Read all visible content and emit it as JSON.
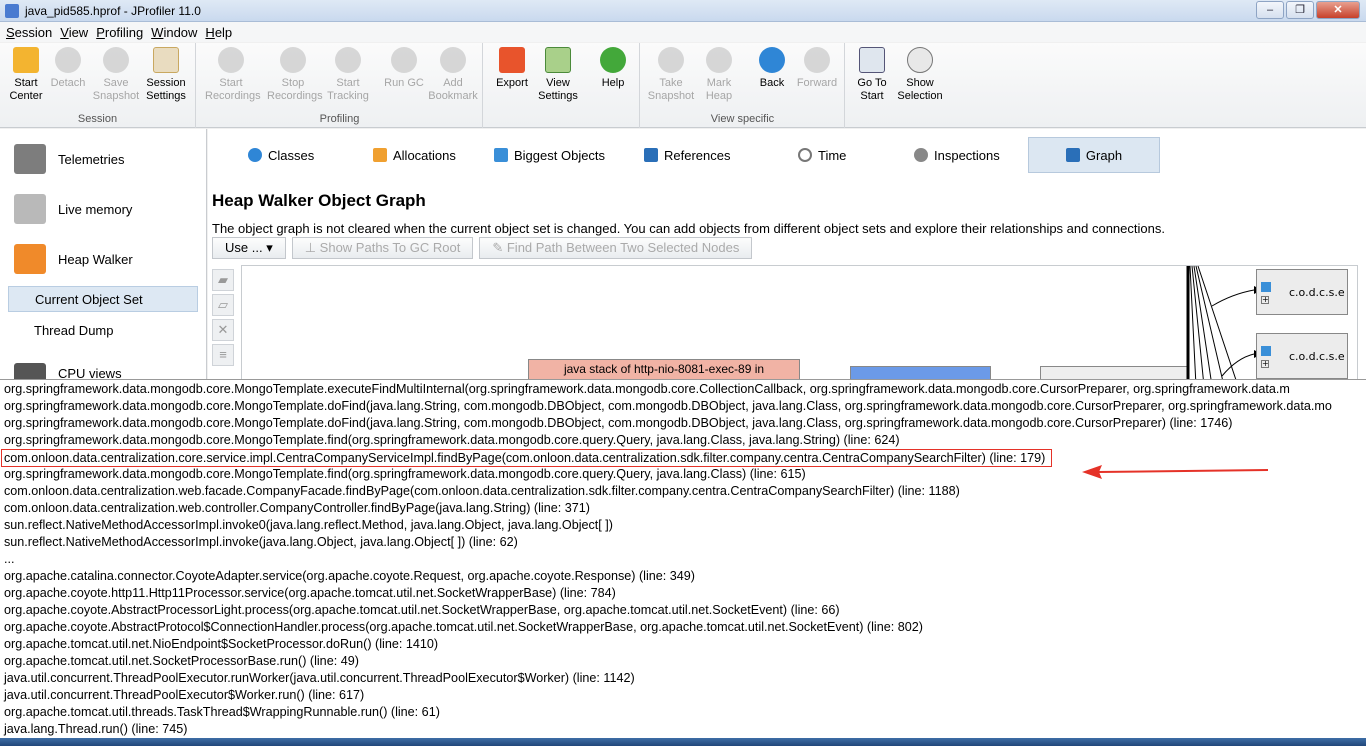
{
  "window": {
    "title": "java_pid585.hprof - JProfiler 11.0"
  },
  "menu": [
    "Session",
    "View",
    "Profiling",
    "Window",
    "Help"
  ],
  "toolbar": {
    "groups": [
      {
        "label": "Session",
        "buttons": [
          {
            "label": "Start\nCenter",
            "icon": "folder-start-icon",
            "enabled": true
          },
          {
            "label": "Detach",
            "icon": "detach-icon",
            "enabled": false
          },
          {
            "label": "Save\nSnapshot",
            "icon": "save-snapshot-icon",
            "enabled": false
          },
          {
            "label": "Session\nSettings",
            "icon": "session-settings-icon",
            "enabled": true
          }
        ]
      },
      {
        "label": "Profiling",
        "buttons": [
          {
            "label": "Start\nRecordings",
            "icon": "start-recordings-icon",
            "enabled": false
          },
          {
            "label": "Stop\nRecordings",
            "icon": "stop-recordings-icon",
            "enabled": false
          },
          {
            "label": "Start\nTracking",
            "icon": "start-tracking-icon",
            "enabled": false
          },
          {
            "label": "Run GC",
            "icon": "run-gc-icon",
            "enabled": false
          },
          {
            "label": "Add\nBookmark",
            "icon": "add-bookmark-icon",
            "enabled": false
          }
        ]
      },
      {
        "label": "",
        "buttons": [
          {
            "label": "Export",
            "icon": "export-icon",
            "enabled": true
          },
          {
            "label": "View\nSettings",
            "icon": "view-settings-icon",
            "enabled": true
          },
          {
            "label": "Help",
            "icon": "help-icon",
            "enabled": true
          }
        ]
      },
      {
        "label": "View specific",
        "buttons": [
          {
            "label": "Take\nSnapshot",
            "icon": "take-snapshot-icon",
            "enabled": false
          },
          {
            "label": "Mark\nHeap",
            "icon": "mark-heap-icon",
            "enabled": false
          },
          {
            "label": "Back",
            "icon": "back-icon",
            "enabled": true
          },
          {
            "label": "Forward",
            "icon": "forward-icon",
            "enabled": false
          }
        ]
      },
      {
        "label": "",
        "buttons": [
          {
            "label": "Go To\nStart",
            "icon": "go-to-start-icon",
            "enabled": true
          },
          {
            "label": "Show\nSelection",
            "icon": "show-selection-icon",
            "enabled": true
          }
        ]
      }
    ]
  },
  "nav": {
    "telemetries": "Telemetries",
    "live_memory": "Live memory",
    "heap_walker": "Heap Walker",
    "current_object_set": "Current Object Set",
    "thread_dump": "Thread Dump",
    "cpu_views": "CPU views"
  },
  "tabs": [
    "Classes",
    "Allocations",
    "Biggest Objects",
    "References",
    "Time",
    "Inspections",
    "Graph"
  ],
  "graph": {
    "heading": "Heap Walker Object Graph",
    "description": "The object graph is not cleared when the current object set is changed. You can add objects from different object sets and explore their relationships and connections.",
    "use_button": "Use ...",
    "show_paths": "Show Paths To GC Root",
    "find_path": "Find Path Between Two Selected Nodes",
    "node_pink": "java stack of http-nio-8081-exec-89 in",
    "node_right_1": "c.o.d.c.s.e",
    "node_right_2": "c.o.d.c.s.e"
  },
  "colors": {
    "accent": "#dce7f2",
    "highlight": "#e53228",
    "graph_node_stack": "#f1b3a5",
    "graph_node_blue": "#6b9ae8"
  },
  "trace": [
    "org.springframework.data.mongodb.core.MongoTemplate.executeFindMultiInternal(org.springframework.data.mongodb.core.CollectionCallback, org.springframework.data.mongodb.core.CursorPreparer, org.springframework.data.m",
    "org.springframework.data.mongodb.core.MongoTemplate.doFind(java.lang.String, com.mongodb.DBObject, com.mongodb.DBObject, java.lang.Class, org.springframework.data.mongodb.core.CursorPreparer, org.springframework.data.mo",
    "org.springframework.data.mongodb.core.MongoTemplate.doFind(java.lang.String, com.mongodb.DBObject, com.mongodb.DBObject, java.lang.Class, org.springframework.data.mongodb.core.CursorPreparer) (line: 1746)",
    "org.springframework.data.mongodb.core.MongoTemplate.find(org.springframework.data.mongodb.core.query.Query, java.lang.Class, java.lang.String) (line: 624)",
    "com.onloon.data.centralization.core.service.impl.CentraCompanyServiceImpl.findByPage(com.onloon.data.centralization.sdk.filter.company.centra.CentraCompanySearchFilter) (line: 179)",
    "org.springframework.data.mongodb.core.MongoTemplate.find(org.springframework.data.mongodb.core.query.Query, java.lang.Class) (line: 615)",
    "com.onloon.data.centralization.web.facade.CompanyFacade.findByPage(com.onloon.data.centralization.sdk.filter.company.centra.CentraCompanySearchFilter) (line: 1188)",
    "com.onloon.data.centralization.web.controller.CompanyController.findByPage(java.lang.String) (line: 371)",
    "sun.reflect.NativeMethodAccessorImpl.invoke0(java.lang.reflect.Method, java.lang.Object, java.lang.Object[ ])",
    "sun.reflect.NativeMethodAccessorImpl.invoke(java.lang.Object, java.lang.Object[ ]) (line: 62)",
    "...",
    "org.apache.catalina.connector.CoyoteAdapter.service(org.apache.coyote.Request, org.apache.coyote.Response) (line: 349)",
    "org.apache.coyote.http11.Http11Processor.service(org.apache.tomcat.util.net.SocketWrapperBase) (line: 784)",
    "org.apache.coyote.AbstractProcessorLight.process(org.apache.tomcat.util.net.SocketWrapperBase, org.apache.tomcat.util.net.SocketEvent) (line: 66)",
    "org.apache.coyote.AbstractProtocol$ConnectionHandler.process(org.apache.tomcat.util.net.SocketWrapperBase, org.apache.tomcat.util.net.SocketEvent) (line: 802)",
    "org.apache.tomcat.util.net.NioEndpoint$SocketProcessor.doRun() (line: 1410)",
    "org.apache.tomcat.util.net.SocketProcessorBase.run() (line: 49)",
    "java.util.concurrent.ThreadPoolExecutor.runWorker(java.util.concurrent.ThreadPoolExecutor$Worker) (line: 1142)",
    "java.util.concurrent.ThreadPoolExecutor$Worker.run() (line: 617)",
    "org.apache.tomcat.util.threads.TaskThread$WrappingRunnable.run() (line: 61)",
    "java.lang.Thread.run() (line: 745)"
  ],
  "trace_highlight_index": 4
}
